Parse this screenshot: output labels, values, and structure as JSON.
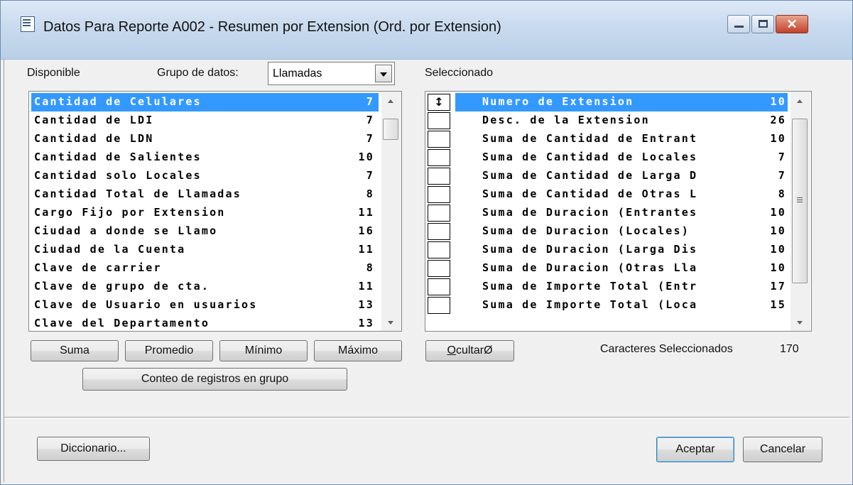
{
  "window": {
    "title": "Datos Para Reporte A002 - Resumen por Extension (Ord. por Extension)",
    "close_glyph": "✕"
  },
  "available": {
    "label": "Disponible",
    "group_label": "Grupo de datos:",
    "group_value": "Llamadas",
    "items": [
      {
        "name": "Cantidad de Celulares",
        "size": "7",
        "selected": true
      },
      {
        "name": "Cantidad de LDI",
        "size": "7"
      },
      {
        "name": "Cantidad de LDN",
        "size": "7"
      },
      {
        "name": "Cantidad de Salientes",
        "size": "10"
      },
      {
        "name": "Cantidad solo Locales",
        "size": "7"
      },
      {
        "name": "Cantidad Total de Llamadas",
        "size": "8"
      },
      {
        "name": "Cargo Fijo por Extension",
        "size": "11"
      },
      {
        "name": "Ciudad a donde se Llamo",
        "size": "16"
      },
      {
        "name": "Ciudad de la Cuenta",
        "size": "11"
      },
      {
        "name": "Clave de carrier",
        "size": "8"
      },
      {
        "name": "Clave de grupo de cta.",
        "size": "11"
      },
      {
        "name": "Clave de Usuario en usuarios",
        "size": "13"
      },
      {
        "name": "Clave del Departamento",
        "size": "13"
      }
    ],
    "buttons": {
      "sum": "Suma",
      "average": "Promedio",
      "minimum": "Mínimo",
      "maximum": "Máximo",
      "count": "Conteo de registros en grupo"
    }
  },
  "selected": {
    "label": "Seleccionado",
    "sort_glyph": "↕",
    "items": [
      {
        "name": "Numero de Extension",
        "size": "10",
        "selected": true
      },
      {
        "name": "Desc. de la Extension",
        "size": "26"
      },
      {
        "name": "Suma de Cantidad de Entrant",
        "size": "10"
      },
      {
        "name": "Suma de Cantidad de Locales",
        "size": "7"
      },
      {
        "name": "Suma de Cantidad de Larga D",
        "size": "7"
      },
      {
        "name": "Suma de Cantidad de Otras L",
        "size": "8"
      },
      {
        "name": "Suma de Duracion (Entrantes",
        "size": "10"
      },
      {
        "name": "Suma de Duracion (Locales)",
        "size": "10"
      },
      {
        "name": "Suma de Duracion (Larga Dis",
        "size": "10"
      },
      {
        "name": "Suma de Duracion (Otras Lla",
        "size": "10"
      },
      {
        "name": "Suma de Importe Total (Entr",
        "size": "17"
      },
      {
        "name": "Suma de Importe Total (Loca",
        "size": "15"
      }
    ],
    "hide_button": {
      "accel": "O",
      "rest": "cultarØ"
    },
    "chars_label": "Caracteres Seleccionados",
    "chars_value": "170"
  },
  "footer": {
    "dictionary": "Diccionario...",
    "accept": "Aceptar",
    "cancel": "Cancelar"
  }
}
